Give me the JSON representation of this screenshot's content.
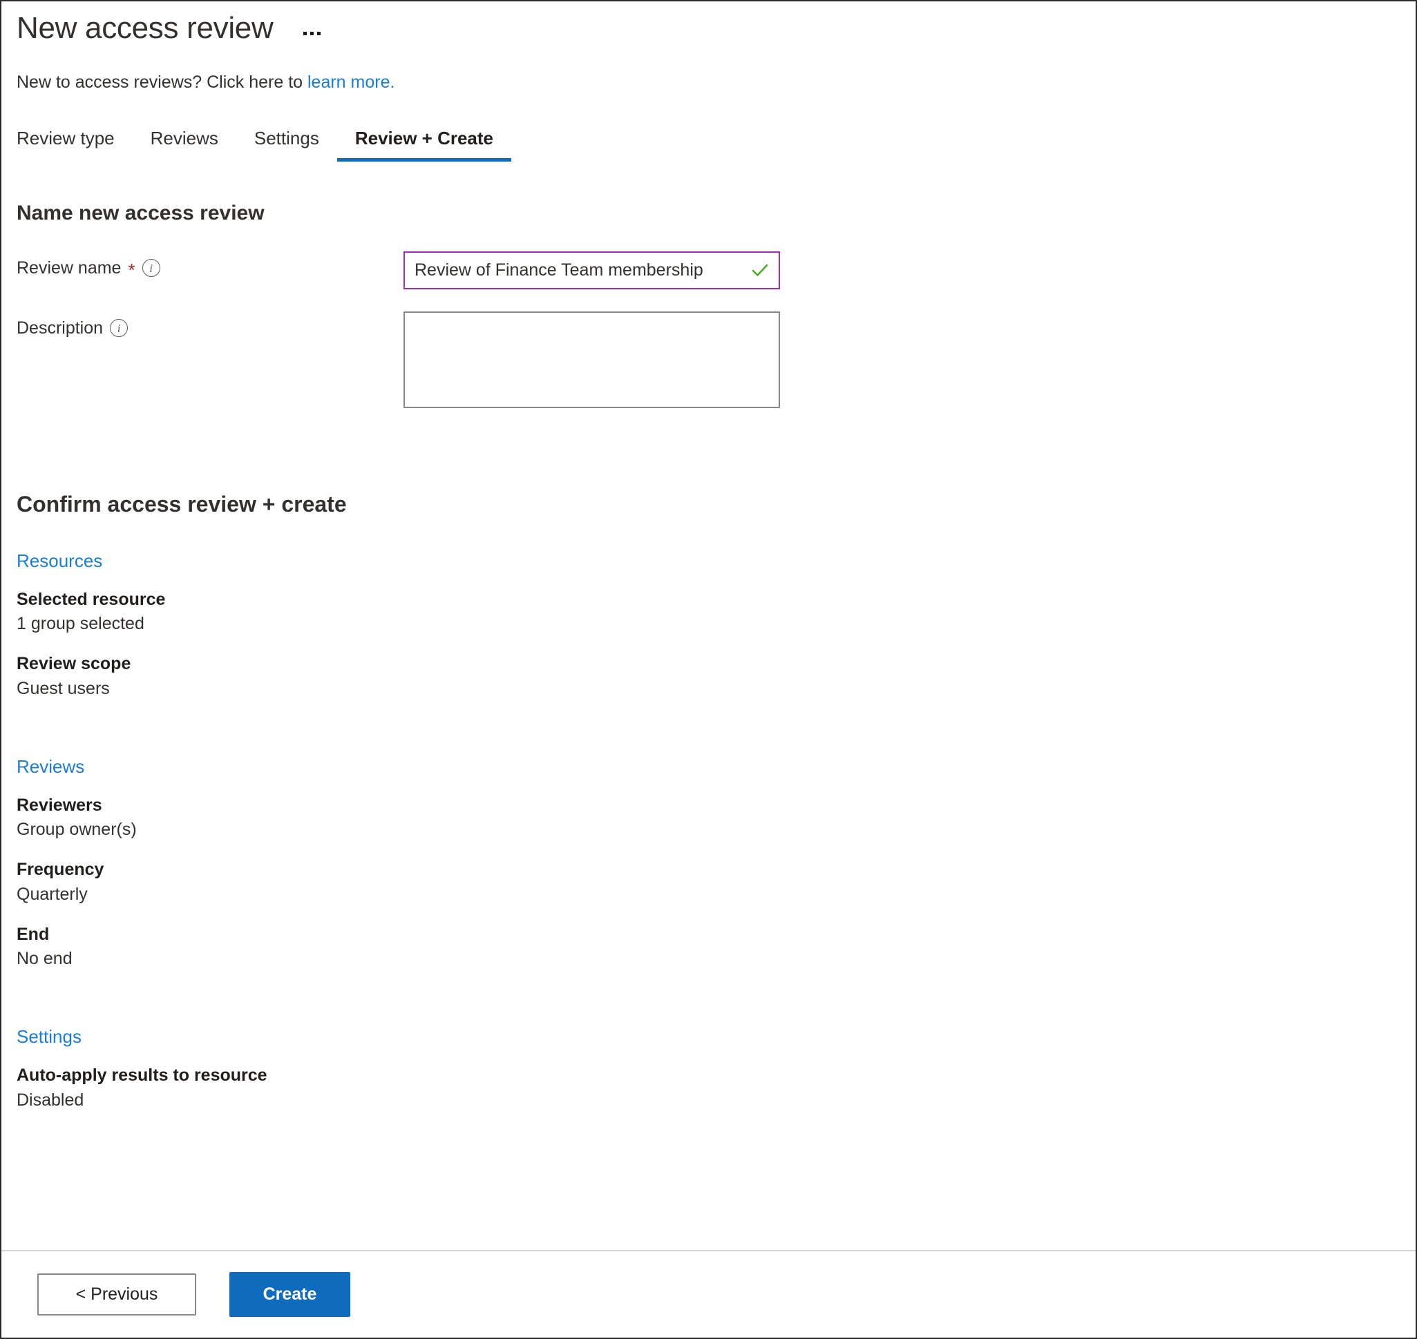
{
  "header": {
    "title": "New access review",
    "more_menu_label": "...",
    "subtitle_prefix": "New to access reviews? Click here to ",
    "subtitle_link": "learn more."
  },
  "tabs": [
    {
      "label": "Review type",
      "active": false
    },
    {
      "label": "Reviews",
      "active": false
    },
    {
      "label": "Settings",
      "active": false
    },
    {
      "label": "Review + Create",
      "active": true
    }
  ],
  "name_section": {
    "heading": "Name new access review",
    "review_name": {
      "label": "Review name",
      "required_marker": "*",
      "info_icon": "info-icon",
      "value": "Review of Finance Team membership",
      "placeholder": "",
      "validation_icon": "checkmark-icon"
    },
    "description": {
      "label": "Description",
      "info_icon": "info-icon",
      "value": "",
      "placeholder": ""
    }
  },
  "confirm_section": {
    "heading": "Confirm access review + create",
    "groups": [
      {
        "title": "Resources",
        "items": [
          {
            "label": "Selected resource",
            "value": "1 group selected"
          },
          {
            "label": "Review scope",
            "value": "Guest users"
          }
        ]
      },
      {
        "title": "Reviews",
        "items": [
          {
            "label": "Reviewers",
            "value": "Group owner(s)"
          },
          {
            "label": "Frequency",
            "value": "Quarterly"
          },
          {
            "label": "End",
            "value": "No end"
          }
        ]
      },
      {
        "title": "Settings",
        "items": [
          {
            "label": "Auto-apply results to resource",
            "value": "Disabled"
          }
        ]
      }
    ]
  },
  "footer": {
    "previous_label": "< Previous",
    "create_label": "Create"
  },
  "colors": {
    "accent_blue": "#0f6cbd",
    "link_blue": "#1a7fd4",
    "focus_purple": "#9b2fae",
    "valid_green": "#4eaa25",
    "required_red": "#a4262c"
  }
}
